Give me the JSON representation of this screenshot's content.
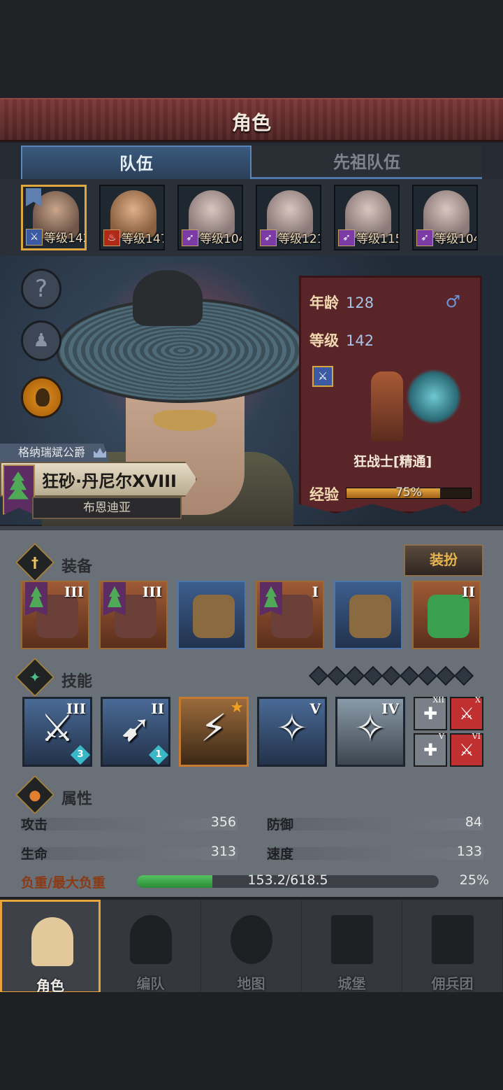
{
  "header": {
    "title": "角色"
  },
  "tabs": [
    {
      "label": "队伍",
      "active": true
    },
    {
      "label": "先祖队伍",
      "active": false
    }
  ],
  "party": [
    {
      "level_text": "等级142",
      "class_icon": "sword-icon",
      "color": "#3c5aa4",
      "selected": true
    },
    {
      "level_text": "等级147",
      "class_icon": "flame-icon",
      "color": "#b02a1a",
      "selected": false
    },
    {
      "level_text": "等级104",
      "class_icon": "bow-icon",
      "color": "#7a3ca4",
      "selected": false
    },
    {
      "level_text": "等级121",
      "class_icon": "bow-icon",
      "color": "#7a3ca4",
      "selected": false
    },
    {
      "level_text": "等级115",
      "class_icon": "bow-icon",
      "color": "#7a3ca4",
      "selected": false
    },
    {
      "level_text": "等级104",
      "class_icon": "bow-icon",
      "color": "#7a3ca4",
      "selected": false
    }
  ],
  "hero": {
    "title": "格纳瑞斌公爵",
    "name": "狂砂·丹尼尔XVIII",
    "realm": "布恩迪亚"
  },
  "info": {
    "age_label": "年龄",
    "age_value": "128",
    "level_label": "等级",
    "level_value": "142",
    "gender_icon": "male-icon",
    "class_name": "狂战士[精通]",
    "exp_label": "经验",
    "exp_text": "75%",
    "exp_fraction": 0.75
  },
  "equipment": {
    "title": "装备",
    "outfit_label": "装扮",
    "slots": [
      {
        "roman": "III",
        "banner": true,
        "style": "orange"
      },
      {
        "roman": "III",
        "banner": true,
        "style": "orange"
      },
      {
        "roman": "",
        "banner": false,
        "style": "blue"
      },
      {
        "roman": "I",
        "banner": true,
        "style": "orange"
      },
      {
        "roman": "",
        "banner": false,
        "style": "blue"
      },
      {
        "roman": "II",
        "banner": false,
        "style": "orange"
      }
    ]
  },
  "skills": {
    "title": "技能",
    "items": [
      {
        "roman": "III",
        "badge": "3",
        "style": "blue"
      },
      {
        "roman": "II",
        "badge": "1",
        "style": "blue"
      },
      {
        "roman": "",
        "badge": "",
        "style": "gold"
      },
      {
        "roman": "V",
        "badge": "",
        "style": "blue"
      },
      {
        "roman": "IV",
        "badge": "",
        "style": "silver"
      }
    ],
    "mini": [
      {
        "roman": "XII",
        "style": "grey"
      },
      {
        "roman": "X",
        "style": "red"
      },
      {
        "roman": "V",
        "style": "grey"
      },
      {
        "roman": "VI",
        "style": "red"
      }
    ]
  },
  "attributes": {
    "title": "属性",
    "attack_label": "攻击",
    "attack_value": "356",
    "defense_label": "防御",
    "defense_value": "84",
    "life_label": "生命",
    "life_value": "313",
    "speed_label": "速度",
    "speed_value": "133",
    "load_label": "负重/最大负重",
    "load_text": "153.2/618.5",
    "load_pct": "25%",
    "load_fraction": 0.25
  },
  "nav": [
    {
      "label": "角色",
      "active": true
    },
    {
      "label": "编队",
      "active": false
    },
    {
      "label": "地图",
      "active": false
    },
    {
      "label": "城堡",
      "active": false
    },
    {
      "label": "佣兵团",
      "active": false
    }
  ]
}
